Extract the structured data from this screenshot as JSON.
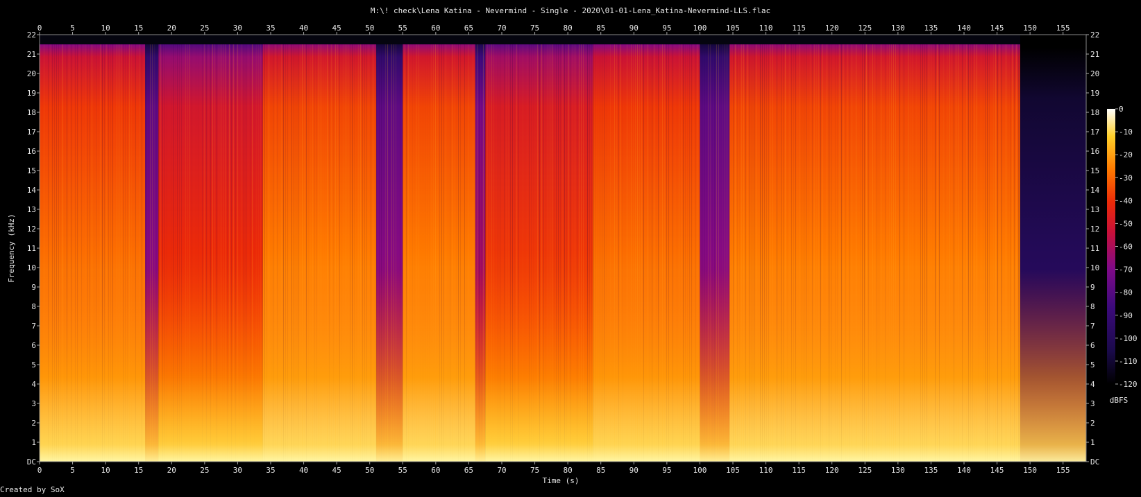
{
  "chart_data": {
    "type": "heatmap",
    "title": "M:\\! check\\Lena Katina - Nevermind - Single - 2020\\01-01-Lena_Katina-Nevermind-LLS.flac",
    "xlabel": "Time (s)",
    "ylabel": "Frequency (kHz)",
    "x_ticks": [
      "0",
      "5",
      "10",
      "15",
      "20",
      "25",
      "30",
      "35",
      "40",
      "45",
      "50",
      "55",
      "60",
      "65",
      "70",
      "75",
      "80",
      "85",
      "90",
      "95",
      "100",
      "105",
      "110",
      "115",
      "120",
      "125",
      "130",
      "135",
      "140",
      "145",
      "150",
      "155"
    ],
    "y_ticks": [
      "DC",
      "1",
      "2",
      "3",
      "4",
      "5",
      "6",
      "7",
      "8",
      "9",
      "10",
      "11",
      "12",
      "13",
      "14",
      "15",
      "16",
      "17",
      "18",
      "19",
      "20",
      "21",
      "22"
    ],
    "xlim": [
      0,
      158.5
    ],
    "ylim": [
      0,
      22
    ],
    "colorbar": {
      "label": "dBFS",
      "ticks": [
        "0",
        "-10",
        "-20",
        "-30",
        "-40",
        "-50",
        "-60",
        "-70",
        "-80",
        "-90",
        "-100",
        "-110",
        "-120"
      ],
      "range": [
        -120,
        0
      ]
    },
    "segments": [
      {
        "t0": 0.0,
        "t1": 16.0,
        "level": 0.78,
        "lowpass_khz": 21.5
      },
      {
        "t0": 16.0,
        "t1": 18.0,
        "level": 0.45,
        "lowpass_khz": 21.5
      },
      {
        "t0": 18.0,
        "t1": 33.8,
        "level": 0.68,
        "lowpass_khz": 21.5
      },
      {
        "t0": 33.8,
        "t1": 51.0,
        "level": 0.8,
        "lowpass_khz": 21.5
      },
      {
        "t0": 51.0,
        "t1": 55.0,
        "level": 0.45,
        "lowpass_khz": 21.5
      },
      {
        "t0": 55.0,
        "t1": 66.0,
        "level": 0.8,
        "lowpass_khz": 21.5
      },
      {
        "t0": 66.0,
        "t1": 67.5,
        "level": 0.5,
        "lowpass_khz": 21.5
      },
      {
        "t0": 67.5,
        "t1": 83.8,
        "level": 0.7,
        "lowpass_khz": 21.5
      },
      {
        "t0": 83.8,
        "t1": 100.0,
        "level": 0.78,
        "lowpass_khz": 21.5
      },
      {
        "t0": 100.0,
        "t1": 104.5,
        "level": 0.45,
        "lowpass_khz": 21.5
      },
      {
        "t0": 104.5,
        "t1": 148.5,
        "level": 0.8,
        "lowpass_khz": 21.5
      },
      {
        "t0": 148.5,
        "t1": 158.5,
        "level": 0.18,
        "lowpass_khz": 22.0
      }
    ]
  },
  "footer": "Created by SoX"
}
